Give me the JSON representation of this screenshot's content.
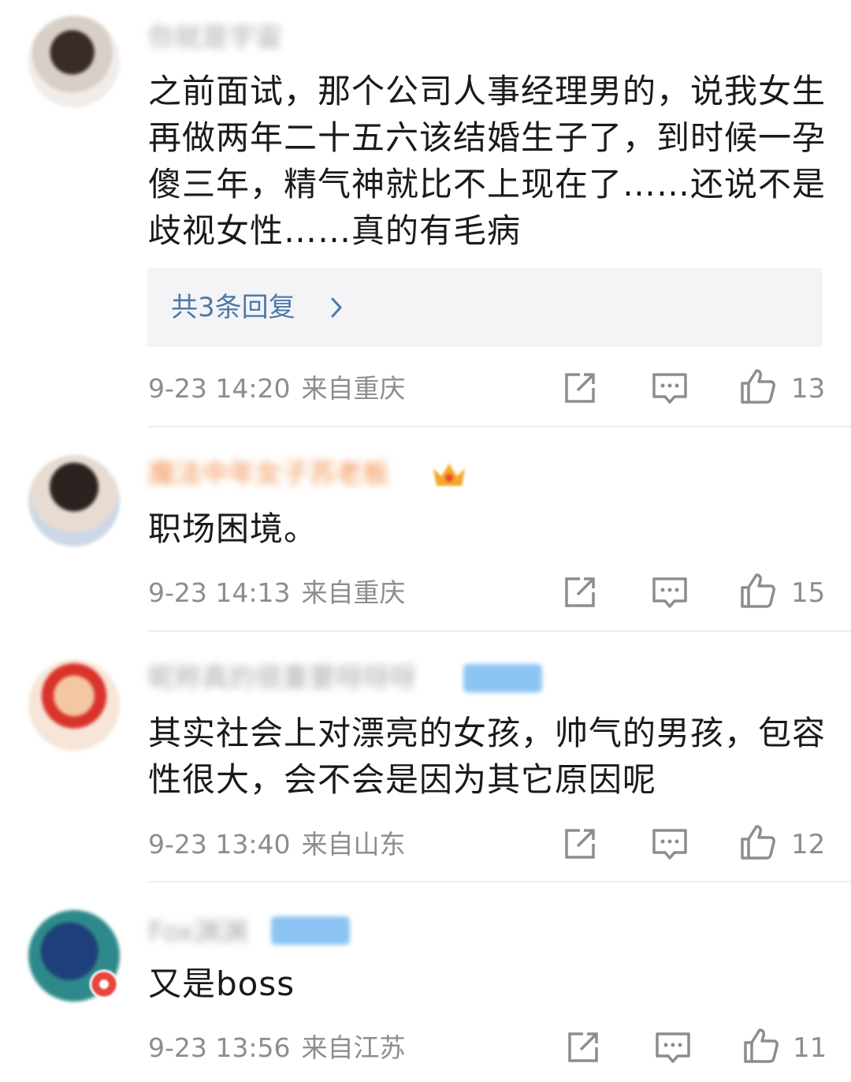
{
  "comments": [
    {
      "username": "你就是宇宙",
      "text": "之前面试，那个公司人事经理男的，说我女生再做两年二十五六该结婚生子了，到时候一孕傻三年，精气神就比不上现在了……还说不是歧视女性……真的有毛病",
      "replies_label": "共3条回复",
      "time": "9-23 14:20",
      "location": "来自重庆",
      "likes": "13"
    },
    {
      "username": "魔法中年女子苏老板",
      "text": "职场困境。",
      "time": "9-23 14:13",
      "location": "来自重庆",
      "likes": "15"
    },
    {
      "username": "昵称真的很重要呀呀呀",
      "text": "其实社会上对漂亮的女孩，帅气的男孩，包容性很大，会不会是因为其它原因呢",
      "time": "9-23 13:40",
      "location": "来自山东",
      "likes": "12"
    },
    {
      "username": "Fox渊渊",
      "text": "又是boss",
      "time": "9-23 13:56",
      "location": "来自江苏",
      "likes": "11"
    }
  ],
  "colors": {
    "username_orange": "#f07a2a",
    "reply_link": "#4d7aa8",
    "meta_gray": "#8d8d8d"
  },
  "icons": [
    "share-icon",
    "comment-icon",
    "like-icon",
    "chevron-right-icon",
    "crown-icon",
    "verified-badge"
  ]
}
